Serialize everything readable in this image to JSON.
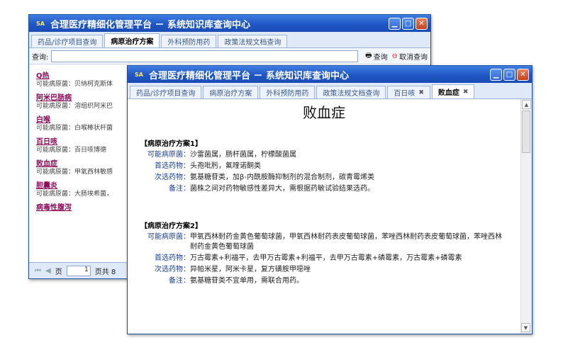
{
  "app_title": "合理医疗精细化管理平台 － 系统知识库查询中心",
  "logo_text": "SA",
  "back_window": {
    "tabs": [
      {
        "label": "药品/诊疗项目查询",
        "active": false
      },
      {
        "label": "病原治疗方案",
        "active": true
      },
      {
        "label": "外科预防用药",
        "active": false
      },
      {
        "label": "政策法规文档查询",
        "active": false
      }
    ],
    "query": {
      "label": "查询:",
      "value": "",
      "search_label": "查询",
      "cancel_label": "取消查询"
    },
    "items": [
      {
        "title": "Q热",
        "desc": "可能病原菌：贝纳柯克斯体"
      },
      {
        "title": "阿米巴肠病",
        "desc": "可能病原菌：溶组织阿米巴"
      },
      {
        "title": "白喉",
        "desc": "可能病原菌：白喉棒状杆菌"
      },
      {
        "title": "百日咳",
        "desc": "可能病原菌：百日咳博德"
      },
      {
        "title": "败血症",
        "desc": "可能病原菌：甲氧西林敏感"
      },
      {
        "title": "胆囊炎",
        "desc": "可能病原菌：大肠埃希菌，"
      },
      {
        "title": "病毒性腹泻",
        "desc": ""
      }
    ],
    "pager": {
      "page_label": "页",
      "page_value": "1",
      "total_label": "页共 8"
    }
  },
  "front_window": {
    "tabs": [
      {
        "label": "药品/诊疗项目查询",
        "active": false,
        "closable": false
      },
      {
        "label": "病原治疗方案",
        "active": false,
        "closable": false
      },
      {
        "label": "外科预防用药",
        "active": false,
        "closable": false
      },
      {
        "label": "政策法规文档查询",
        "active": false,
        "closable": false
      },
      {
        "label": "百日咳",
        "active": false,
        "closable": true
      },
      {
        "label": "败血症",
        "active": true,
        "closable": true
      }
    ],
    "doc": {
      "title": "败血症",
      "sections": [
        {
          "heading": "【病原治疗方案1】",
          "rows": [
            {
              "label": "可能病原菌：",
              "value": "沙雷菌属，肠杆菌属，柠檬酸菌属"
            },
            {
              "label": "首选药物：",
              "value": "头孢吡肟，氟喹诺酮类"
            },
            {
              "label": "次选药物：",
              "value": "氨基糖苷类，加β-内酰胺酶抑制剂的混合制剂，碳青霉烯类"
            },
            {
              "label": "备注：",
              "value": "菌株之间对药物敏感性差异大，需根据药敏试验结果选药。"
            }
          ]
        },
        {
          "heading": "【病原治疗方案2】",
          "rows": [
            {
              "label": "可能病原菌：",
              "value": "甲氧西林耐药金黄色葡萄球菌，甲氧西林耐药表皮葡萄球菌，苯唑西林耐药表皮葡萄球菌，苯唑西林耐药金黄色葡萄球菌"
            },
            {
              "label": "首选药物：",
              "value": "万古霉素+利福平，去甲万古霉素+利福平，去甲万古霉素+磷霉素，万古霉素+磷霉素"
            },
            {
              "label": "次选药物：",
              "value": "异帕米星，阿米卡星，复方磺胺甲噁唑"
            },
            {
              "label": "备注：",
              "value": "氨基糖苷类不宜单用，需联合用药。"
            }
          ]
        }
      ]
    }
  },
  "window_buttons": {
    "minimize": "▁",
    "maximize": "□",
    "close": "✕"
  },
  "colors": {
    "titlebar": "#1f56c4",
    "tab_bg": "#dfe9f7",
    "item_link": "#8b0a5a",
    "label_blue": "#1a3f99"
  }
}
